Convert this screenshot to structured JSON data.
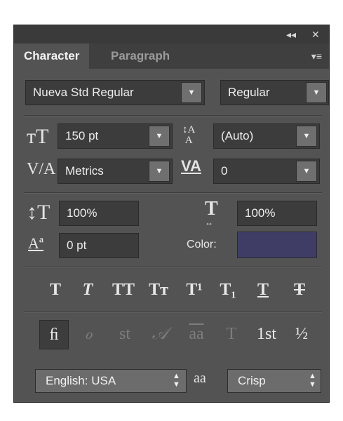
{
  "titlebar": {
    "collapse_icon": "◂◂",
    "close_icon": "✕"
  },
  "tabs": [
    {
      "label": "Character"
    },
    {
      "label": "Paragraph"
    }
  ],
  "font": {
    "family": "Nueva Std Regular",
    "style": "Regular"
  },
  "size": {
    "value": "150 pt"
  },
  "leading": {
    "value": "(Auto)"
  },
  "kerning": {
    "value": "Metrics"
  },
  "tracking": {
    "value": "0"
  },
  "vertical_scale": {
    "value": "100%"
  },
  "horizontal_scale": {
    "value": "100%"
  },
  "baseline_shift": {
    "value": "0 pt"
  },
  "color": {
    "label": "Color:",
    "swatch": "#3f3d66"
  },
  "type_styles": [
    "T",
    "T",
    "TT",
    "Tт",
    "T¹",
    "T₁",
    "T",
    "T"
  ],
  "opentype": [
    "ﬁ",
    "ℴ",
    "st",
    "𝒜",
    "aa",
    "T",
    "1st",
    "½"
  ],
  "language": {
    "value": "English: USA"
  },
  "antialias": {
    "icon": "aa",
    "value": "Crisp"
  }
}
